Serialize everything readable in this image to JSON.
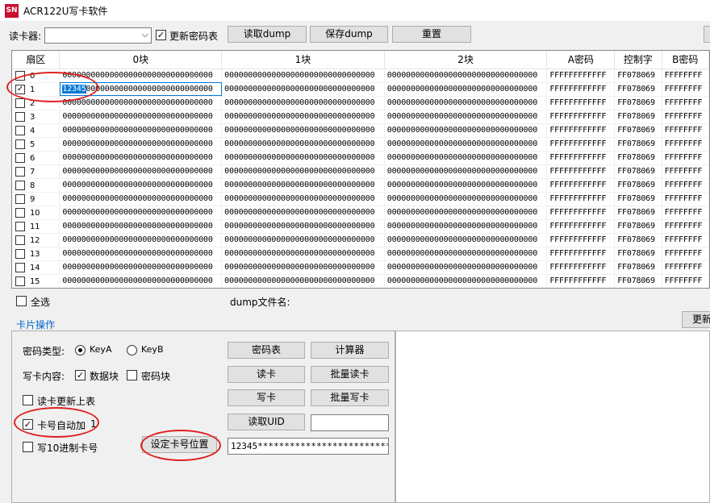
{
  "window": {
    "title": "ACR122U写卡软件",
    "icon_text": "SN"
  },
  "toolbar": {
    "reader_label": "读卡器:",
    "reader_value": "",
    "update_pw_label": "更新密码表",
    "update_pw_checked": true,
    "read_dump": "读取dump",
    "save_dump": "保存dump",
    "reset": "重置"
  },
  "grid": {
    "headers": [
      "扇区",
      "0块",
      "1块",
      "2块",
      "A密码",
      "控制字",
      "B密码"
    ],
    "block_value": "00000000000000000000000000000000",
    "row1_block0_selected": "12345",
    "row1_block0_rest": "000000000000000000000000000",
    "key_a": "FFFFFFFFFFFF",
    "access": "FF078069",
    "key_b": "FFFFFFFF",
    "sectors": [
      "0",
      "1",
      "2",
      "3",
      "4",
      "5",
      "6",
      "7",
      "8",
      "9",
      "10",
      "11",
      "12",
      "13",
      "14",
      "15"
    ],
    "checked_sector": 1
  },
  "below_grid": {
    "select_all": "全选",
    "dump_filename_label": "dump文件名:",
    "update_button": "更新"
  },
  "ops": {
    "title": "卡片操作",
    "pw_type_label": "密码类型:",
    "key_a": "KeyA",
    "key_b": "KeyB",
    "key_a_selected": true,
    "write_content_label": "写卡内容:",
    "data_block": "数据块",
    "data_block_checked": true,
    "pw_block": "密码块",
    "pw_block_checked": false,
    "read_update_label": "读卡更新上表",
    "read_update_checked": false,
    "auto_inc_label": "卡号自动加",
    "auto_inc_checked": true,
    "auto_inc_value": "1",
    "write_dec_label": "写10进制卡号",
    "write_dec_checked": false,
    "set_pos_button": "设定卡号位置",
    "pw_table_button": "密码表",
    "calculator_button": "计算器",
    "read_card_button": "读卡",
    "batch_read_button": "批量读卡",
    "write_card_button": "写卡",
    "batch_write_button": "批量写卡",
    "read_uid_button": "读取UID",
    "uid_value": "",
    "card_number_field": "12345****************************"
  },
  "colors": {
    "accent": "#0078d7",
    "annotation": "#e02020",
    "section_title": "#0066cc"
  }
}
